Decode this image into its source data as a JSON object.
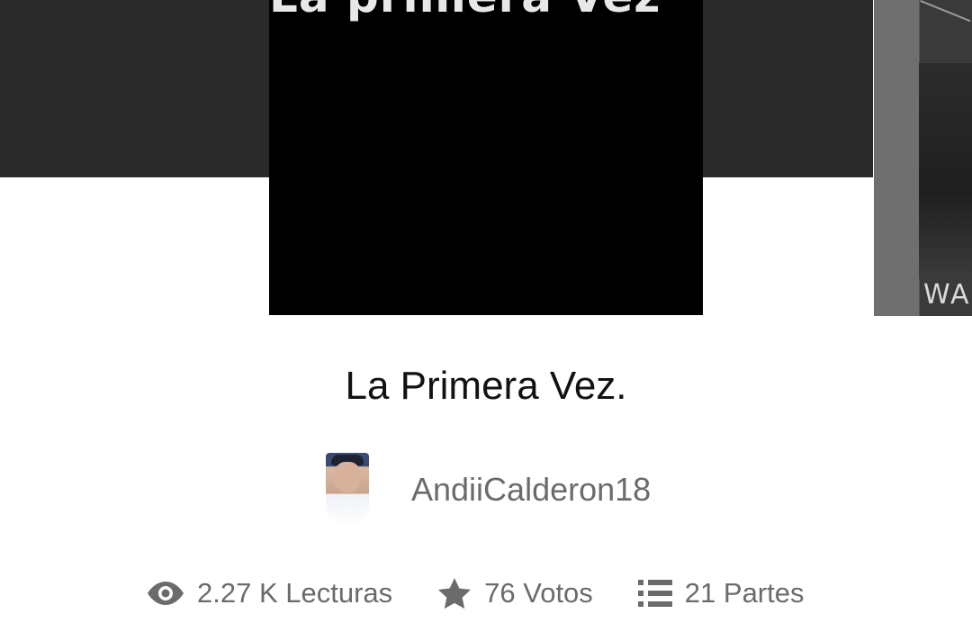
{
  "story": {
    "cover_text": "La primera Vez",
    "title": "La Primera Vez.",
    "author": "AndiiCalderon18"
  },
  "next_story": {
    "cover_caption": "WAL"
  },
  "stats": {
    "reads": "2.27 K Lecturas",
    "votes": "76 Votos",
    "parts": "21 Partes"
  },
  "icons": {
    "reads": "eye-icon",
    "votes": "star-icon",
    "parts": "list-icon"
  },
  "colors": {
    "header_band": "#2a2a2a",
    "text_primary": "#121212",
    "text_secondary": "#6b6b6b"
  }
}
